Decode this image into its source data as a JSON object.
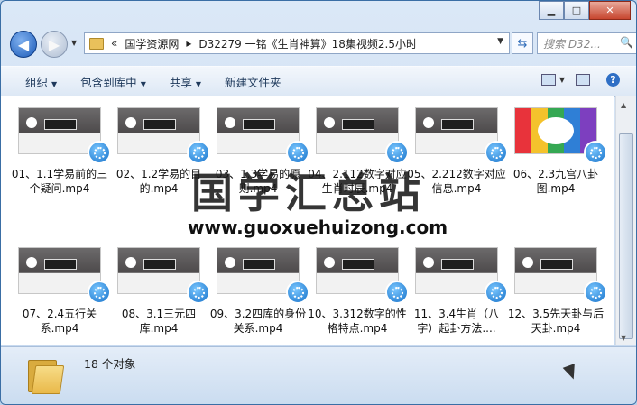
{
  "window": {
    "caption": {
      "minimize": "▁",
      "maximize": "□",
      "close": "✕"
    }
  },
  "nav": {
    "back_icon": "back-arrow-icon",
    "forward_icon": "forward-arrow-icon",
    "breadcrumb_prefix": "«",
    "breadcrumb": [
      "国学资源网",
      "D32279 一铭《生肖神算》18集视频2.5小时"
    ],
    "separator": "▸",
    "refresh_icon": "⇆",
    "search_placeholder": "搜索 D32...",
    "search_icon": "🔍"
  },
  "toolbar": {
    "organize": "组织",
    "include_library": "包含到库中",
    "share": "共享",
    "new_folder": "新建文件夹"
  },
  "files": [
    {
      "name": "01、1.1学易前的三个疑问.mp4"
    },
    {
      "name": "02、1.2学易的目的.mp4"
    },
    {
      "name": "03、1.3学易的原则.mp4"
    },
    {
      "name": "04、2.112数字对应生肖时辰.mp4"
    },
    {
      "name": "05、2.212数字对应信息.mp4"
    },
    {
      "name": "06、2.3九宫八卦图.mp4"
    },
    {
      "name": "07、2.4五行关系.mp4"
    },
    {
      "name": "08、3.1三元四库.mp4"
    },
    {
      "name": "09、3.2四库的身份关系.mp4"
    },
    {
      "name": "10、3.312数字的性格特点.mp4"
    },
    {
      "name": "11、3.4生肖（八字）起卦方法...."
    },
    {
      "name": "12、3.5先天卦与后天卦.mp4"
    }
  ],
  "status": {
    "count": "18 个对象"
  },
  "watermark": {
    "cn": "国学汇总站",
    "url": "www.guoxuehuizong.com"
  }
}
